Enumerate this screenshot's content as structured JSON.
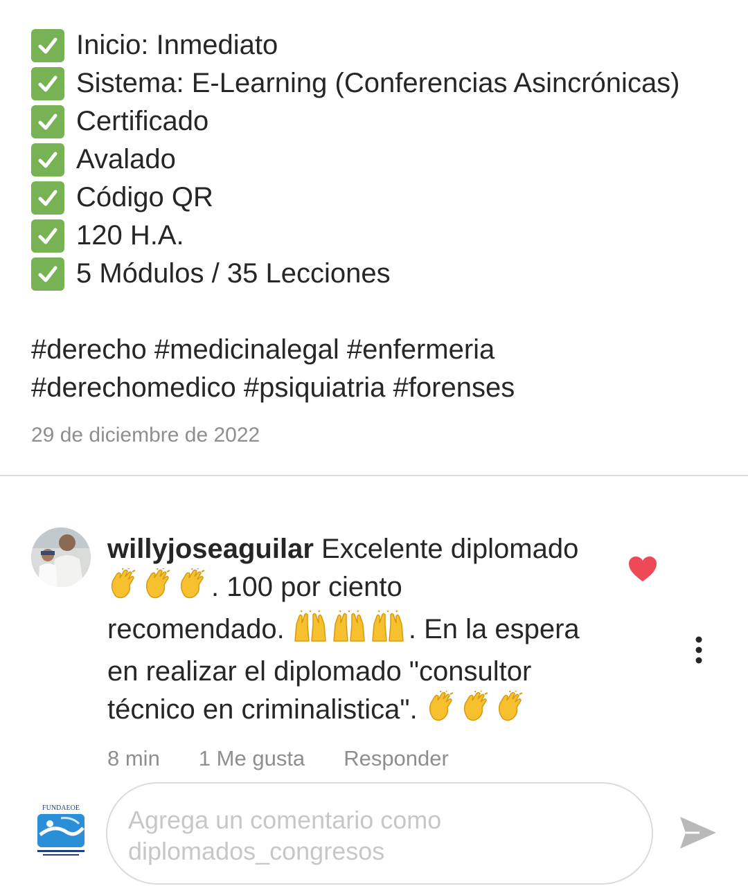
{
  "post": {
    "features": [
      {
        "icon": "check-mark-icon",
        "text": "Inicio: Inmediato"
      },
      {
        "icon": "check-mark-icon",
        "text": "Sistema: E-Learning (Conferencias Asincrónicas)"
      },
      {
        "icon": "check-mark-icon",
        "text": "Certificado"
      },
      {
        "icon": "check-mark-icon",
        "text": "Avalado"
      },
      {
        "icon": "check-mark-icon",
        "text": "Código QR"
      },
      {
        "icon": "check-mark-icon",
        "text": "120 H.A."
      },
      {
        "icon": "check-mark-icon",
        "text": "5 Módulos / 35 Lecciones"
      }
    ],
    "hashtags_line1": "#derecho #medicinalegal #enfermeria",
    "hashtags_line2": "#derechomedico #psiquiatria  #forenses",
    "date": "29 de diciembre de 2022"
  },
  "comment": {
    "username": "willyjoseaguilar",
    "text_1": "Excelente diplomado",
    "text_2": ". 100 por ciento",
    "text_3": "recomendado.",
    "text_4": ". En la espera",
    "text_5": "en realizar  el diplomado \"consultor",
    "text_6": "técnico en criminalistica\".",
    "emojis": [
      "clapping-hands",
      "raising-hands"
    ],
    "time": "8 min",
    "likes": "1 Me gusta",
    "reply_label": "Responder",
    "liked": true
  },
  "composer": {
    "placeholder": "Agrega un comentario como diplomados_congresos",
    "logo_text": "FUNDAEOE"
  },
  "colors": {
    "text": "#262626",
    "muted": "#8e8e8e",
    "heart": "#ed4956",
    "check": "#77b255"
  }
}
